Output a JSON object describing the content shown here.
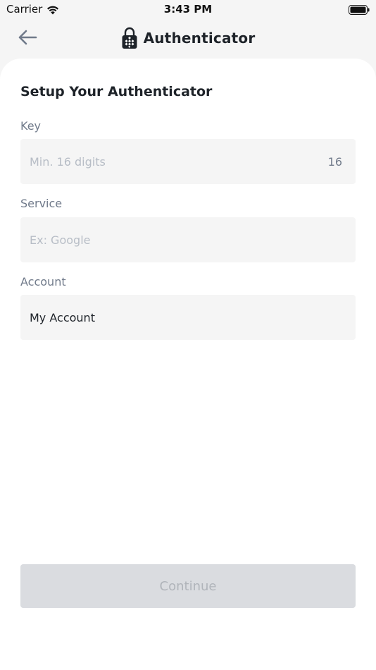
{
  "status_bar": {
    "carrier": "Carrier",
    "time": "3:43 PM"
  },
  "header": {
    "title": "Authenticator",
    "back_icon": "arrow-left-icon",
    "logo_icon": "lock-icon"
  },
  "form": {
    "title": "Setup Your Authenticator",
    "key": {
      "label": "Key",
      "placeholder": "Min. 16 digits",
      "value": "",
      "counter": "16"
    },
    "service": {
      "label": "Service",
      "placeholder": "Ex: Google",
      "value": ""
    },
    "account": {
      "label": "Account",
      "placeholder": "",
      "value": "My Account"
    },
    "continue_label": "Continue"
  },
  "colors": {
    "background": "#f5f5f5",
    "card": "#ffffff",
    "text_primary": "#1e2329",
    "text_secondary": "#707a8a",
    "placeholder": "#b7bdc6",
    "button_disabled": "#dadce0",
    "button_disabled_text": "#b0b4ba"
  }
}
